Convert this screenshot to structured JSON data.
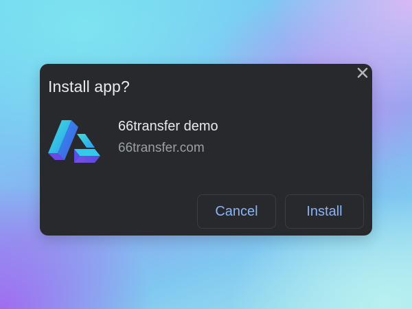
{
  "dialog": {
    "title": "Install app?",
    "close_icon": "close-icon",
    "app": {
      "icon": "app-logo-icon",
      "name": "66transfer demo",
      "origin": "66transfer.com"
    },
    "buttons": {
      "cancel_label": "Cancel",
      "install_label": "Install"
    }
  },
  "colors": {
    "dialog_background": "#28292c",
    "primary_text": "#e8eaed",
    "secondary_text": "#9aa0a6",
    "button_text": "#8ab4f8",
    "button_border": "#3c3e42"
  }
}
